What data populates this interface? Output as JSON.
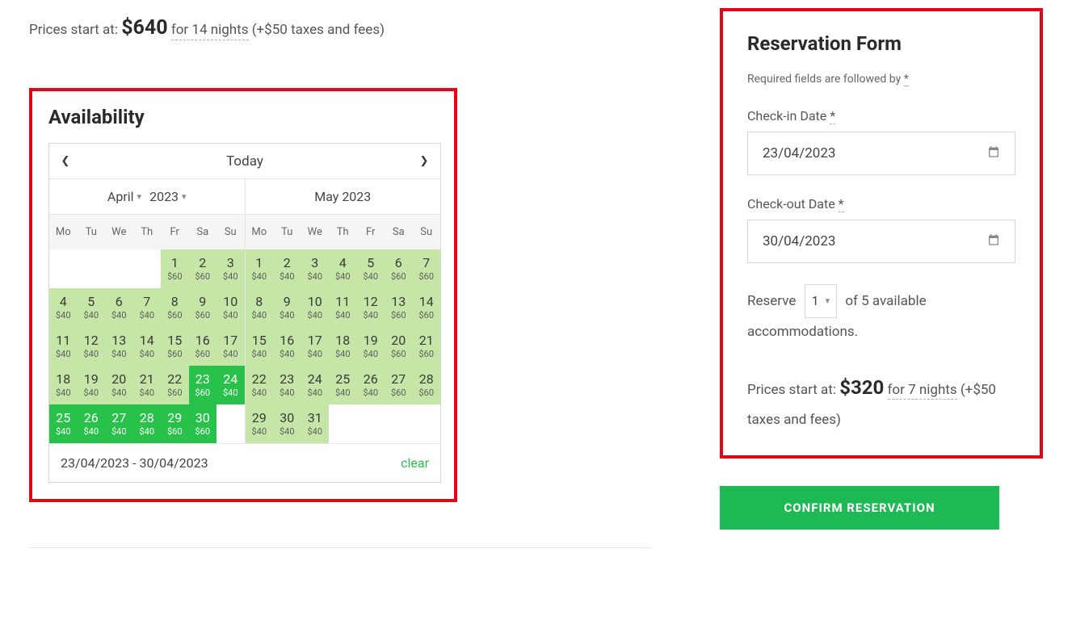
{
  "top_price": {
    "prefix": "Prices start at:",
    "amount": "$640",
    "nights": "for 14 nights",
    "fees": "(+$50 taxes and fees)"
  },
  "availability": {
    "title": "Availability",
    "today_label": "Today",
    "footer_range": "23/04/2023 - 30/04/2023",
    "clear_label": "clear",
    "dow": [
      "Mo",
      "Tu",
      "We",
      "Th",
      "Fr",
      "Sa",
      "Su"
    ],
    "month_left": {
      "month": "April",
      "year": "2023",
      "lead_empty": 4,
      "days": [
        {
          "n": 1,
          "p": "$60",
          "cls": "avail60"
        },
        {
          "n": 2,
          "p": "$60",
          "cls": "avail60"
        },
        {
          "n": 3,
          "p": "$40",
          "cls": "avail"
        },
        {
          "n": 4,
          "p": "$40",
          "cls": "avail"
        },
        {
          "n": 5,
          "p": "$40",
          "cls": "avail"
        },
        {
          "n": 6,
          "p": "$40",
          "cls": "avail"
        },
        {
          "n": 7,
          "p": "$40",
          "cls": "avail"
        },
        {
          "n": 8,
          "p": "$60",
          "cls": "avail60"
        },
        {
          "n": 9,
          "p": "$60",
          "cls": "avail60"
        },
        {
          "n": 10,
          "p": "$40",
          "cls": "avail"
        },
        {
          "n": 11,
          "p": "$40",
          "cls": "avail"
        },
        {
          "n": 12,
          "p": "$40",
          "cls": "avail"
        },
        {
          "n": 13,
          "p": "$40",
          "cls": "avail"
        },
        {
          "n": 14,
          "p": "$40",
          "cls": "avail"
        },
        {
          "n": 15,
          "p": "$60",
          "cls": "avail60"
        },
        {
          "n": 16,
          "p": "$60",
          "cls": "avail60"
        },
        {
          "n": 17,
          "p": "$40",
          "cls": "avail"
        },
        {
          "n": 18,
          "p": "$40",
          "cls": "avail"
        },
        {
          "n": 19,
          "p": "$40",
          "cls": "avail"
        },
        {
          "n": 20,
          "p": "$40",
          "cls": "avail"
        },
        {
          "n": 21,
          "p": "$40",
          "cls": "avail"
        },
        {
          "n": 22,
          "p": "$60",
          "cls": "avail60"
        },
        {
          "n": 23,
          "p": "$60",
          "cls": "start"
        },
        {
          "n": 24,
          "p": "$40",
          "cls": "range"
        },
        {
          "n": 25,
          "p": "$40",
          "cls": "range"
        },
        {
          "n": 26,
          "p": "$40",
          "cls": "range"
        },
        {
          "n": 27,
          "p": "$40",
          "cls": "range"
        },
        {
          "n": 28,
          "p": "$40",
          "cls": "range"
        },
        {
          "n": 29,
          "p": "$60",
          "cls": "range"
        },
        {
          "n": 30,
          "p": "$60",
          "cls": "range"
        }
      ],
      "trail_empty": 0
    },
    "month_right": {
      "title": "May 2023",
      "lead_empty": 0,
      "days": [
        {
          "n": 1,
          "p": "$40",
          "cls": "avail"
        },
        {
          "n": 2,
          "p": "$40",
          "cls": "avail"
        },
        {
          "n": 3,
          "p": "$40",
          "cls": "avail"
        },
        {
          "n": 4,
          "p": "$40",
          "cls": "avail"
        },
        {
          "n": 5,
          "p": "$40",
          "cls": "avail"
        },
        {
          "n": 6,
          "p": "$60",
          "cls": "avail60"
        },
        {
          "n": 7,
          "p": "$60",
          "cls": "avail60"
        },
        {
          "n": 8,
          "p": "$40",
          "cls": "avail"
        },
        {
          "n": 9,
          "p": "$40",
          "cls": "avail"
        },
        {
          "n": 10,
          "p": "$40",
          "cls": "avail"
        },
        {
          "n": 11,
          "p": "$40",
          "cls": "avail"
        },
        {
          "n": 12,
          "p": "$40",
          "cls": "avail"
        },
        {
          "n": 13,
          "p": "$60",
          "cls": "avail60"
        },
        {
          "n": 14,
          "p": "$60",
          "cls": "avail60"
        },
        {
          "n": 15,
          "p": "$40",
          "cls": "avail"
        },
        {
          "n": 16,
          "p": "$40",
          "cls": "avail"
        },
        {
          "n": 17,
          "p": "$40",
          "cls": "avail"
        },
        {
          "n": 18,
          "p": "$40",
          "cls": "avail"
        },
        {
          "n": 19,
          "p": "$40",
          "cls": "avail"
        },
        {
          "n": 20,
          "p": "$60",
          "cls": "avail60"
        },
        {
          "n": 21,
          "p": "$60",
          "cls": "avail60"
        },
        {
          "n": 22,
          "p": "$40",
          "cls": "avail"
        },
        {
          "n": 23,
          "p": "$40",
          "cls": "avail"
        },
        {
          "n": 24,
          "p": "$40",
          "cls": "avail"
        },
        {
          "n": 25,
          "p": "$40",
          "cls": "avail"
        },
        {
          "n": 26,
          "p": "$40",
          "cls": "avail"
        },
        {
          "n": 27,
          "p": "$60",
          "cls": "avail60"
        },
        {
          "n": 28,
          "p": "$60",
          "cls": "avail60"
        },
        {
          "n": 29,
          "p": "$40",
          "cls": "avail"
        },
        {
          "n": 30,
          "p": "$40",
          "cls": "avail"
        },
        {
          "n": 31,
          "p": "$40",
          "cls": "avail"
        }
      ],
      "trail_empty": 4
    }
  },
  "form": {
    "title": "Reservation Form",
    "required_line": "Required fields are followed by ",
    "star": "*",
    "checkin_label": "Check-in Date ",
    "checkin_value": "23/04/2023",
    "checkout_label": "Check-out Date ",
    "checkout_value": "30/04/2023",
    "reserve_pre": "Reserve",
    "reserve_qty": "1",
    "reserve_post": "of 5 available accommodations.",
    "price_prefix": "Prices start at:",
    "price_amount": "$320",
    "price_nights": "for 7 nights",
    "price_fees": "(+$50 taxes and fees)",
    "confirm_label": "CONFIRM RESERVATION"
  }
}
